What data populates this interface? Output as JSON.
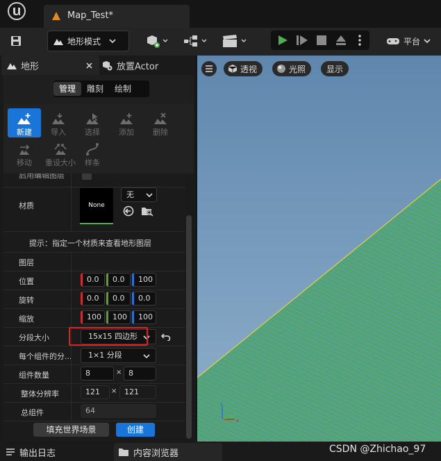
{
  "window": {
    "doc_tab": "Map_Test*"
  },
  "toolbar": {
    "mode_label": "地形模式",
    "platform_label": "平台"
  },
  "panel": {
    "tab_landscape": "地形",
    "tab_place_actor": "放置Actor",
    "segments": [
      "管理",
      "雕刻",
      "绘制"
    ],
    "tools": [
      {
        "label": "新建",
        "icon": "new-landscape-icon"
      },
      {
        "label": "导入",
        "icon": "import-icon"
      },
      {
        "label": "选择",
        "icon": "select-icon"
      },
      {
        "label": "添加",
        "icon": "add-icon"
      },
      {
        "label": "删除",
        "icon": "delete-icon"
      },
      {
        "label": "移动",
        "icon": "move-icon"
      },
      {
        "label": "重设大小",
        "icon": "resize-icon"
      },
      {
        "label": "样条",
        "icon": "spline-icon"
      }
    ],
    "cut_row_label": "启用编辑图层",
    "material_label": "材质",
    "material_thumb": "None",
    "material_dropdown": "无",
    "hint": "提示：指定一个材质来查看地形图层",
    "layers_label": "图层",
    "location_label": "位置",
    "location": [
      "0.0",
      "0.0",
      "100"
    ],
    "rotation_label": "旋转",
    "rotation": [
      "0.0",
      "0.0",
      "0.0"
    ],
    "scale_label": "缩放",
    "scale": [
      "100",
      "100",
      "100"
    ],
    "section_size_label": "分段大小",
    "section_size": "15x15 四边形",
    "sections_per_comp_label": "每个组件的分...",
    "sections_per_comp": "1×1 分段",
    "comp_count_label": "组件数量",
    "comp_count": [
      "8",
      "8"
    ],
    "resolution_label": "整体分辨率",
    "resolution": [
      "121",
      "121"
    ],
    "total_comp_label": "总组件",
    "total_comp": "64",
    "fill_button": "填充世界场景",
    "create_button": "创建",
    "times": "×"
  },
  "viewport": {
    "perspective": "透视",
    "lit": "光照",
    "show": "显示"
  },
  "bottom": {
    "output_log": "输出日志",
    "content_browser": "内容浏览器"
  },
  "watermark": "CSDN @Zhichao_97",
  "colors": {
    "accent": "#1976d8",
    "highlight": "#e02020",
    "play": "#4caf50",
    "grid": "#00d000",
    "sky": "#6f95b8"
  }
}
